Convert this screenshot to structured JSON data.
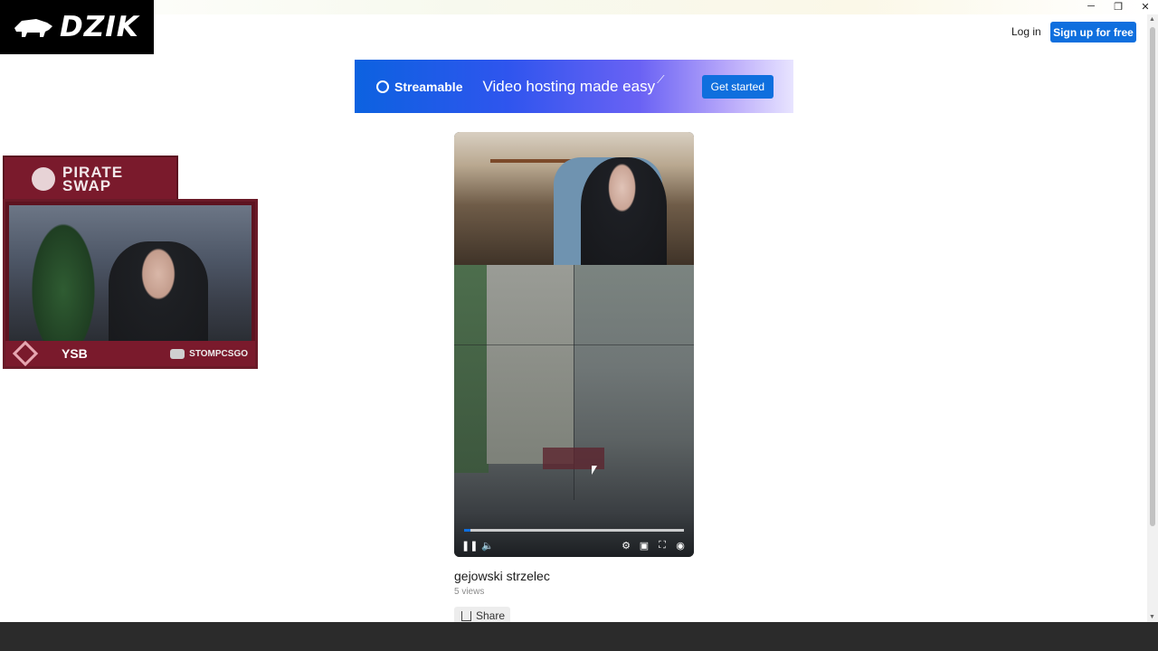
{
  "window": {
    "minimize_glyph": "─",
    "restore_glyph": "❐",
    "close_glyph": "✕"
  },
  "overlay_brand": {
    "text": "DZIK"
  },
  "header": {
    "login_label": "Log in",
    "signup_label": "Sign up for free"
  },
  "banner": {
    "brand": "Streamable",
    "tagline": "Video hosting made easy",
    "cta_label": "Get started",
    "accent": "#0f6fde"
  },
  "stream_overlay": {
    "sponsor_line1": "PIRATE",
    "sponsor_line2": "SWAP",
    "badge_text": "YSB",
    "channel_name": "STOMPCSGO"
  },
  "player": {
    "progress": 0.03,
    "play_state_icon": "pause-icon"
  },
  "video": {
    "title": "gejowski strzelec",
    "views": "5 views",
    "share_label": "Share"
  },
  "colors": {
    "accent": "#0f6fde",
    "footer": "#2b2b2b"
  }
}
